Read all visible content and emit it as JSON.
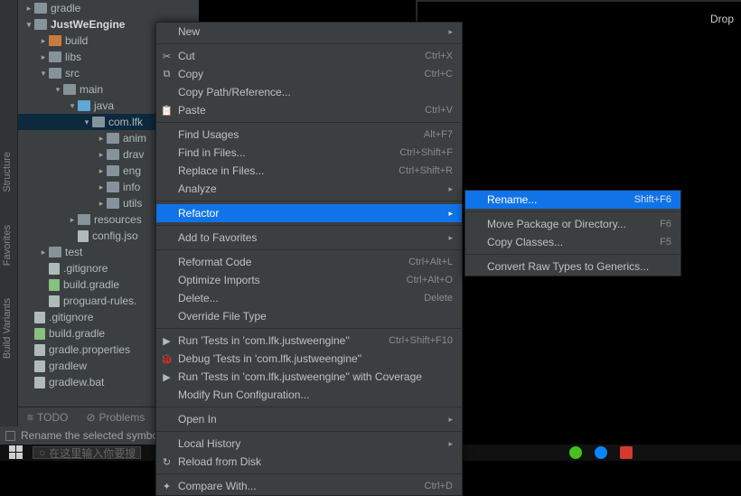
{
  "drop_label": "Drop",
  "sidebar_tabs": [
    "Structure",
    "Favorites",
    "Build Variants"
  ],
  "tree": [
    {
      "indent": 0,
      "arrow": "▸",
      "icon": "folder",
      "text": "gradle"
    },
    {
      "indent": 0,
      "arrow": "▾",
      "icon": "folder",
      "text": "JustWeEngine",
      "bold": true
    },
    {
      "indent": 1,
      "arrow": "▸",
      "icon": "folder org",
      "text": "build"
    },
    {
      "indent": 1,
      "arrow": "▸",
      "icon": "folder",
      "text": "libs"
    },
    {
      "indent": 1,
      "arrow": "▾",
      "icon": "folder",
      "text": "src"
    },
    {
      "indent": 2,
      "arrow": "▾",
      "icon": "folder",
      "text": "main"
    },
    {
      "indent": 3,
      "arrow": "▾",
      "icon": "folder blu",
      "text": "java"
    },
    {
      "indent": 4,
      "arrow": "▾",
      "icon": "folder",
      "text": "com.lfk",
      "sel": true
    },
    {
      "indent": 5,
      "arrow": "▸",
      "icon": "folder",
      "text": "anim"
    },
    {
      "indent": 5,
      "arrow": "▸",
      "icon": "folder",
      "text": "drav"
    },
    {
      "indent": 5,
      "arrow": "▸",
      "icon": "folder",
      "text": "eng"
    },
    {
      "indent": 5,
      "arrow": "▸",
      "icon": "folder",
      "text": "info"
    },
    {
      "indent": 5,
      "arrow": "▸",
      "icon": "folder",
      "text": "utils"
    },
    {
      "indent": 3,
      "arrow": "▸",
      "icon": "folder",
      "text": "resources"
    },
    {
      "indent": 3,
      "arrow": "",
      "icon": "file",
      "text": "config.jso"
    },
    {
      "indent": 1,
      "arrow": "▸",
      "icon": "folder",
      "text": "test"
    },
    {
      "indent": 1,
      "arrow": "",
      "icon": "file",
      "text": ".gitignore"
    },
    {
      "indent": 1,
      "arrow": "",
      "icon": "file gradle",
      "text": "build.gradle"
    },
    {
      "indent": 1,
      "arrow": "",
      "icon": "file",
      "text": "proguard-rules."
    },
    {
      "indent": 0,
      "arrow": "",
      "icon": "file",
      "text": ".gitignore"
    },
    {
      "indent": 0,
      "arrow": "",
      "icon": "file gradle",
      "text": "build.gradle"
    },
    {
      "indent": 0,
      "arrow": "",
      "icon": "file",
      "text": "gradle.properties"
    },
    {
      "indent": 0,
      "arrow": "",
      "icon": "file",
      "text": "gradlew"
    },
    {
      "indent": 0,
      "arrow": "",
      "icon": "file",
      "text": "gradlew.bat"
    }
  ],
  "bottom": {
    "todo": "TODO",
    "problems": "Problems"
  },
  "status": "Rename the selected symbol",
  "search_placeholder": "在这里输入你要搜",
  "menu1": [
    {
      "label": "New",
      "sub": "▸"
    },
    {
      "sep": true
    },
    {
      "icon": "✂",
      "label": "Cut",
      "sc": "Ctrl+X"
    },
    {
      "icon": "⧉",
      "label": "Copy",
      "sc": "Ctrl+C"
    },
    {
      "label": "Copy Path/Reference..."
    },
    {
      "icon": "📋",
      "label": "Paste",
      "sc": "Ctrl+V"
    },
    {
      "sep": true
    },
    {
      "label": "Find Usages",
      "sc": "Alt+F7"
    },
    {
      "label": "Find in Files...",
      "sc": "Ctrl+Shift+F"
    },
    {
      "label": "Replace in Files...",
      "sc": "Ctrl+Shift+R"
    },
    {
      "label": "Analyze",
      "sub": "▸"
    },
    {
      "sep": true
    },
    {
      "label": "Refactor",
      "sub": "▸",
      "hl": true
    },
    {
      "sep": true
    },
    {
      "label": "Add to Favorites",
      "sub": "▸"
    },
    {
      "sep": true
    },
    {
      "label": "Reformat Code",
      "sc": "Ctrl+Alt+L"
    },
    {
      "label": "Optimize Imports",
      "sc": "Ctrl+Alt+O"
    },
    {
      "label": "Delete...",
      "sc": "Delete"
    },
    {
      "label": "Override File Type"
    },
    {
      "sep": true
    },
    {
      "icon": "▶",
      "label": "Run 'Tests in 'com.lfk.justweengine''",
      "sc": "Ctrl+Shift+F10"
    },
    {
      "icon": "🐞",
      "label": "Debug 'Tests in 'com.lfk.justweengine''"
    },
    {
      "icon": "▶",
      "label": "Run 'Tests in 'com.lfk.justweengine'' with Coverage"
    },
    {
      "label": "Modify Run Configuration..."
    },
    {
      "sep": true
    },
    {
      "label": "Open In",
      "sub": "▸"
    },
    {
      "sep": true
    },
    {
      "label": "Local History",
      "sub": "▸"
    },
    {
      "icon": "↻",
      "label": "Reload from Disk"
    },
    {
      "sep": true
    },
    {
      "icon": "✦",
      "label": "Compare With...",
      "sc": "Ctrl+D"
    }
  ],
  "menu2": [
    {
      "label": "Rename...",
      "sc": "Shift+F6",
      "hl": true
    },
    {
      "sep": true
    },
    {
      "label": "Move Package or Directory...",
      "sc": "F6"
    },
    {
      "label": "Copy Classes...",
      "sc": "F5"
    },
    {
      "sep": true
    },
    {
      "label": "Convert Raw Types to Generics..."
    }
  ]
}
